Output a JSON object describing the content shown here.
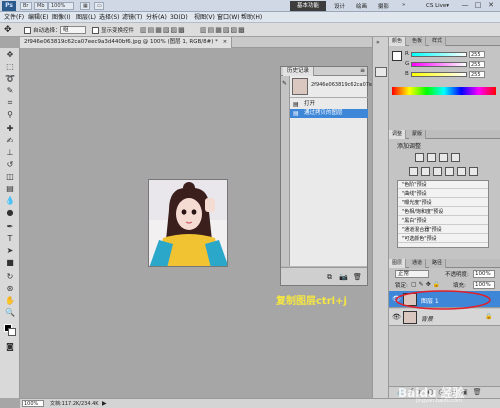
{
  "app": {
    "logo": "Ps",
    "zoom_display": "100%",
    "workspaces": [
      "基本功能",
      "设计",
      "绘画",
      "摄影"
    ],
    "more_workspaces": "»",
    "cs_live": "CS Live▾",
    "window_controls": [
      "—",
      "□",
      "✕"
    ]
  },
  "menu": [
    "文件(F)",
    "编辑(E)",
    "图像(I)",
    "图层(L)",
    "选择(S)",
    "滤镜(T)",
    "分析(A)",
    "3D(D)",
    "视图(V)",
    "窗口(W)",
    "帮助(H)"
  ],
  "options": {
    "auto_select_label": "自动选择：",
    "auto_select_value": "组",
    "show_transform_label": "显示变换控件"
  },
  "document": {
    "tab_title": "2f946e063819c62ca07eec9a3d440bf6.jpg @ 100% (图层 1, RGB/8#) *",
    "tab_close": "×"
  },
  "history": {
    "tab_label": "历史记录",
    "snapshot_name": "2f946e063819c62ca07e...",
    "items": [
      {
        "label": "打开",
        "selected": false
      },
      {
        "label": "通过拷贝的图层",
        "selected": true
      }
    ]
  },
  "color_panel": {
    "tabs": [
      "颜色",
      "色板",
      "样式"
    ],
    "channels": [
      {
        "label": "R",
        "value": "255"
      },
      {
        "label": "G",
        "value": "255"
      },
      {
        "label": "B",
        "value": "255"
      }
    ]
  },
  "adjustments": {
    "tabs": [
      "调整",
      "蒙版"
    ],
    "title": "添加调整",
    "presets": [
      "\"色阶\"预设",
      "\"曲线\"预设",
      "\"曝光度\"预设",
      "\"色相/饱和度\"预设",
      "\"黑白\"预设",
      "\"通道混合器\"预设",
      "\"可选颜色\"预设"
    ]
  },
  "layers": {
    "tabs": [
      "图层",
      "通道",
      "路径"
    ],
    "blend_mode": "正常",
    "opacity_label": "不透明度:",
    "opacity_value": "100%",
    "lock_label": "锁定:",
    "fill_label": "填充:",
    "fill_value": "100%",
    "items": [
      {
        "name": "图层 1",
        "selected": true
      },
      {
        "name": "背景",
        "selected": false
      }
    ]
  },
  "status": {
    "zoom": "100%",
    "doc_info": "文档:117.2K/234.4K"
  },
  "annotation": "复制图层ctrl+j",
  "watermark": "Baidu 经验",
  "watermark_sub": "jingyan.baidu.com",
  "colors": {
    "selection_blue": "#3e86d8",
    "annotation_yellow": "#f5e642",
    "highlight_ellipse": "#e0202a"
  }
}
